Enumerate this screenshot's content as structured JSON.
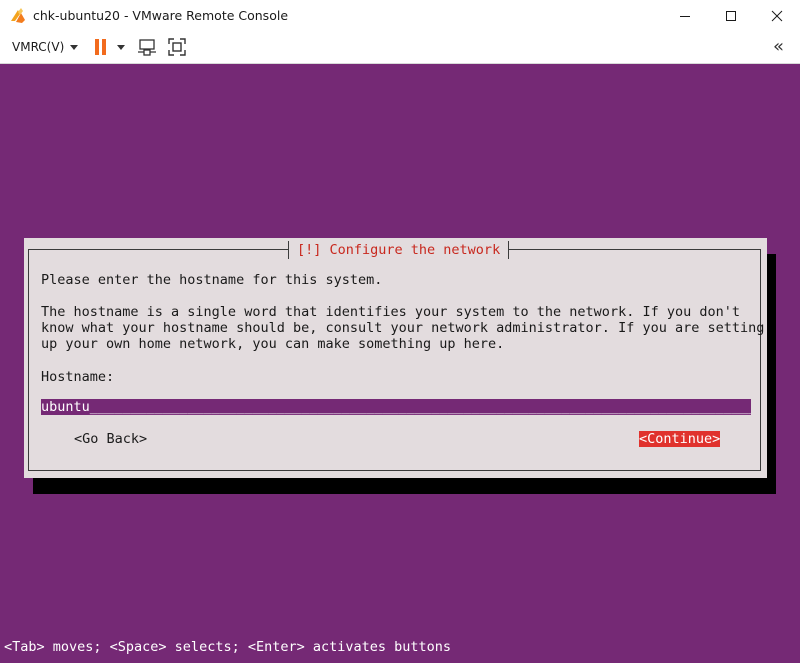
{
  "window": {
    "title": "chk-ubuntu20 - VMware Remote Console"
  },
  "toolbar": {
    "vmrc_label": "VMRC(V)",
    "icons": [
      "pause-icon",
      "send-ctrl-alt-del-icon",
      "fullscreen-icon",
      "collapse-icon"
    ],
    "collapse_label": "«"
  },
  "installer": {
    "dialog_title": "[!] Configure the network",
    "prompt": "Please enter the hostname for this system.",
    "description_lines": [
      "The hostname is a single word that identifies your system to the network. If you don't",
      "know what your hostname should be, consult your network administrator. If you are setting",
      "up your own home network, you can make something up here."
    ],
    "field_label": "Hostname:",
    "hostname_value": "ubuntu",
    "go_back_label": "<Go Back>",
    "continue_label": "<Continue>",
    "status_line": "<Tab> moves; <Space> selects; <Enter> activates buttons"
  },
  "colors": {
    "console_bg": "#752975",
    "dialog_bg": "#e3dcde",
    "title_red": "#c8281e",
    "button_red": "#e0322d",
    "pause_orange": "#f26b1d"
  }
}
